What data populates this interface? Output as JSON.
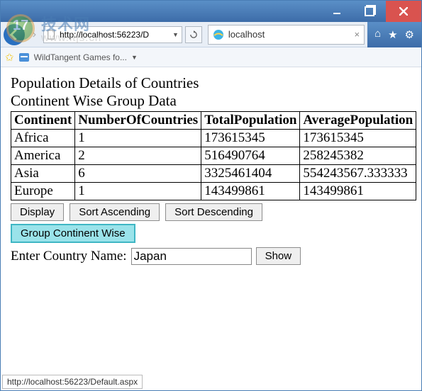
{
  "window": {
    "icons": {
      "min": "min",
      "max": "max",
      "close": "close"
    }
  },
  "nav": {
    "url": "http://localhost:56223/D",
    "refresh_icon": "refresh",
    "tab": {
      "title": "localhost",
      "close": "×"
    },
    "right_icons": {
      "home": "⌂",
      "star": "★",
      "gear": "⚙"
    }
  },
  "bookbar": {
    "item_label": "WildTangent Games fo...",
    "dropdown": "▼"
  },
  "watermark": {
    "badge_num": "17",
    "line1": "技术网",
    "line2": "www.itjs.cn"
  },
  "page": {
    "title1": "Population Details of Countries",
    "title2": "Continent Wise Group Data",
    "columns": [
      "Continent",
      "NumberOfCountries",
      "TotalPopulation",
      "AveragePopulation"
    ],
    "rows": [
      {
        "c0": "Africa",
        "c1": "1",
        "c2": "173615345",
        "c3": "173615345"
      },
      {
        "c0": "America",
        "c1": "2",
        "c2": "516490764",
        "c3": "258245382"
      },
      {
        "c0": "Asia",
        "c1": "6",
        "c2": "3325461404",
        "c3": "554243567.333333"
      },
      {
        "c0": "Europe",
        "c1": "1",
        "c2": "143499861",
        "c3": "143499861"
      }
    ],
    "buttons": {
      "display": "Display",
      "sort_asc": "Sort Ascending",
      "sort_desc": "Sort Descending",
      "group": "Group Continent Wise",
      "show": "Show"
    },
    "input_label": "Enter Country Name:",
    "input_value": "Japan"
  },
  "status": {
    "text": "http://localhost:56223/Default.aspx"
  }
}
